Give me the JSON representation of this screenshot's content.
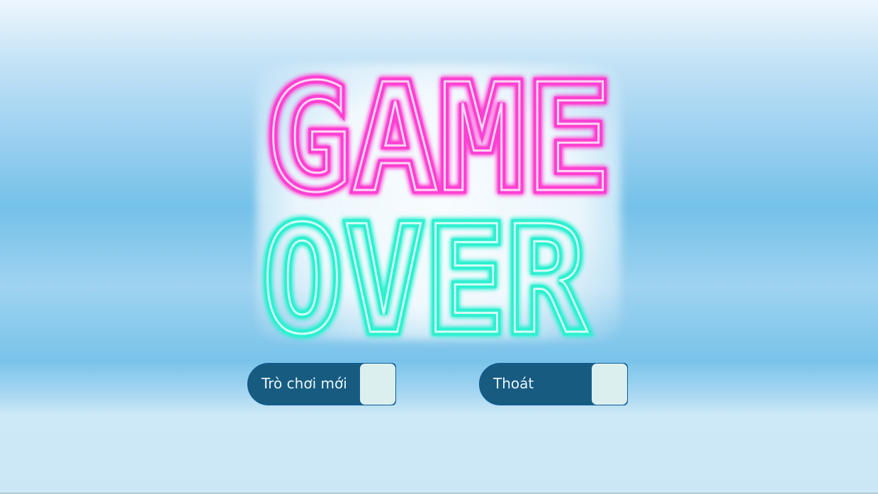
{
  "game_over": {
    "line1": "GAME",
    "line2": "OVER",
    "color_top": "#ff3fd2",
    "color_bottom": "#2ef0d0"
  },
  "buttons": {
    "new_game": "Trò chơi mới",
    "exit": "Thoát"
  },
  "theme": {
    "button_bg": "#175b80",
    "button_border": "#0d5e98",
    "button_tab": "#dcefef",
    "background_light": "#cbe7f5",
    "background_band": "#74c1e9"
  }
}
